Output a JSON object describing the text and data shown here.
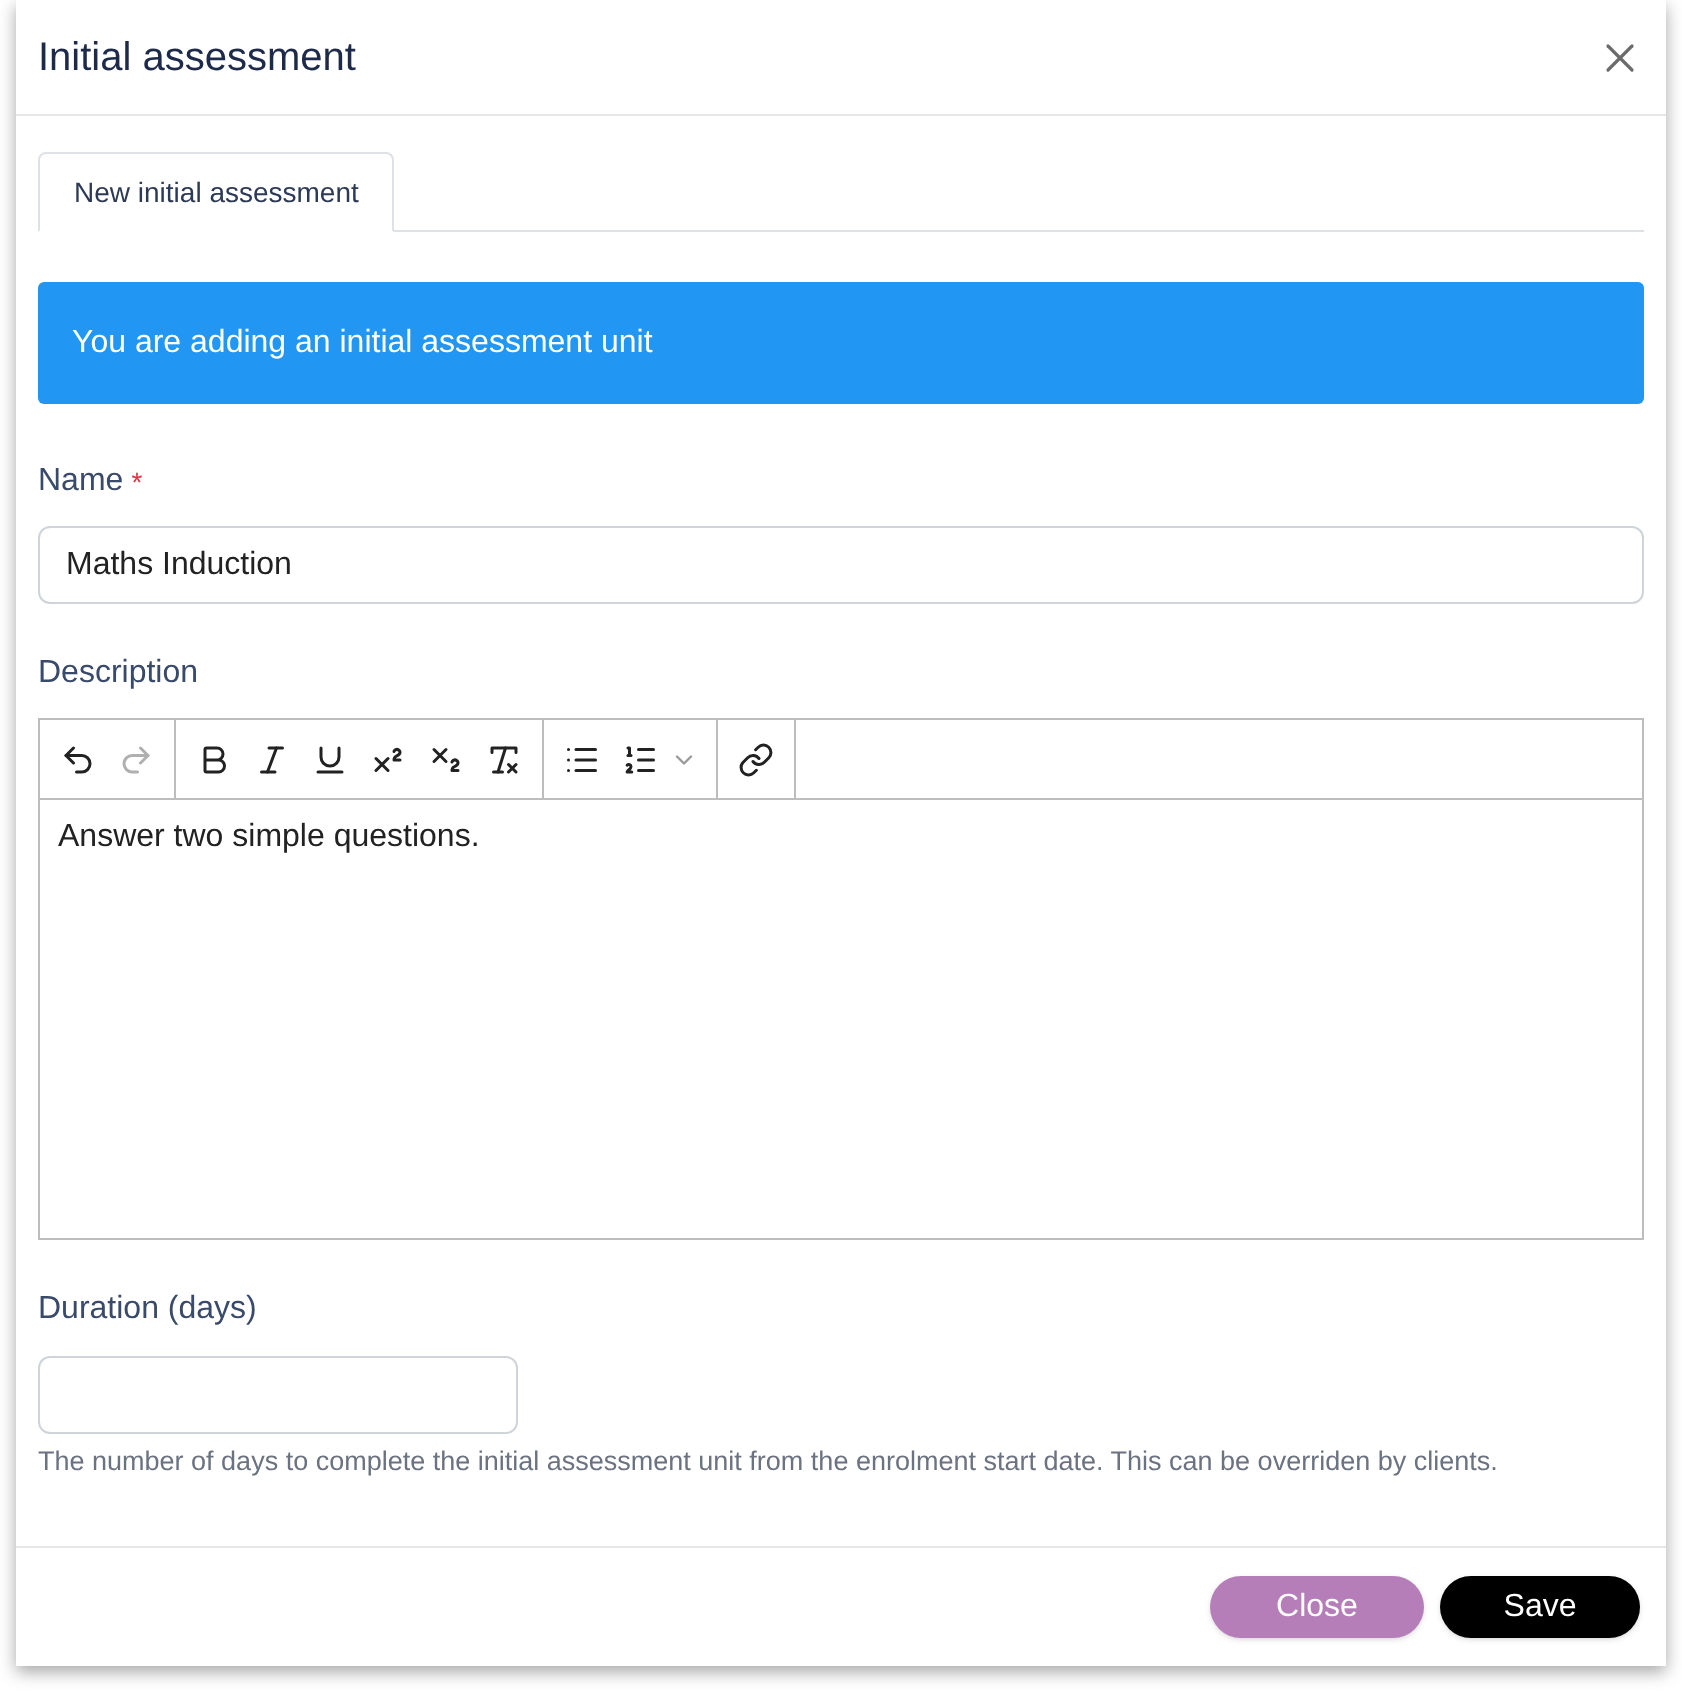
{
  "dialog": {
    "title": "Initial assessment"
  },
  "tabs": [
    {
      "label": "New initial assessment",
      "selected": true
    }
  ],
  "alert": {
    "text": "You are adding an initial assessment unit"
  },
  "name_field": {
    "label": "Name",
    "required_mark": "*",
    "value": "Maths Induction"
  },
  "description": {
    "label": "Description",
    "value": "Answer two simple questions.",
    "toolbar": [
      [
        {
          "kind": "undo",
          "disabled": false
        },
        {
          "kind": "redo",
          "disabled": true
        }
      ],
      [
        {
          "kind": "bold",
          "disabled": false
        },
        {
          "kind": "italic",
          "disabled": false
        },
        {
          "kind": "underline",
          "disabled": false
        },
        {
          "kind": "superscript",
          "disabled": false
        },
        {
          "kind": "subscript",
          "disabled": false
        },
        {
          "kind": "clear",
          "disabled": false
        }
      ],
      [
        {
          "kind": "bullets",
          "disabled": false
        },
        {
          "kind": "numbered",
          "disabled": false
        }
      ],
      [
        {
          "kind": "link",
          "disabled": false
        }
      ]
    ]
  },
  "duration_field": {
    "label": "Duration (days)",
    "help": "The number of days to complete the initial assessment unit from the enrolment start date. This can be overriden by clients."
  },
  "buttons": [
    {
      "kind": "secondary",
      "label": "Close"
    },
    {
      "kind": "primary",
      "label": "Save"
    }
  ]
}
